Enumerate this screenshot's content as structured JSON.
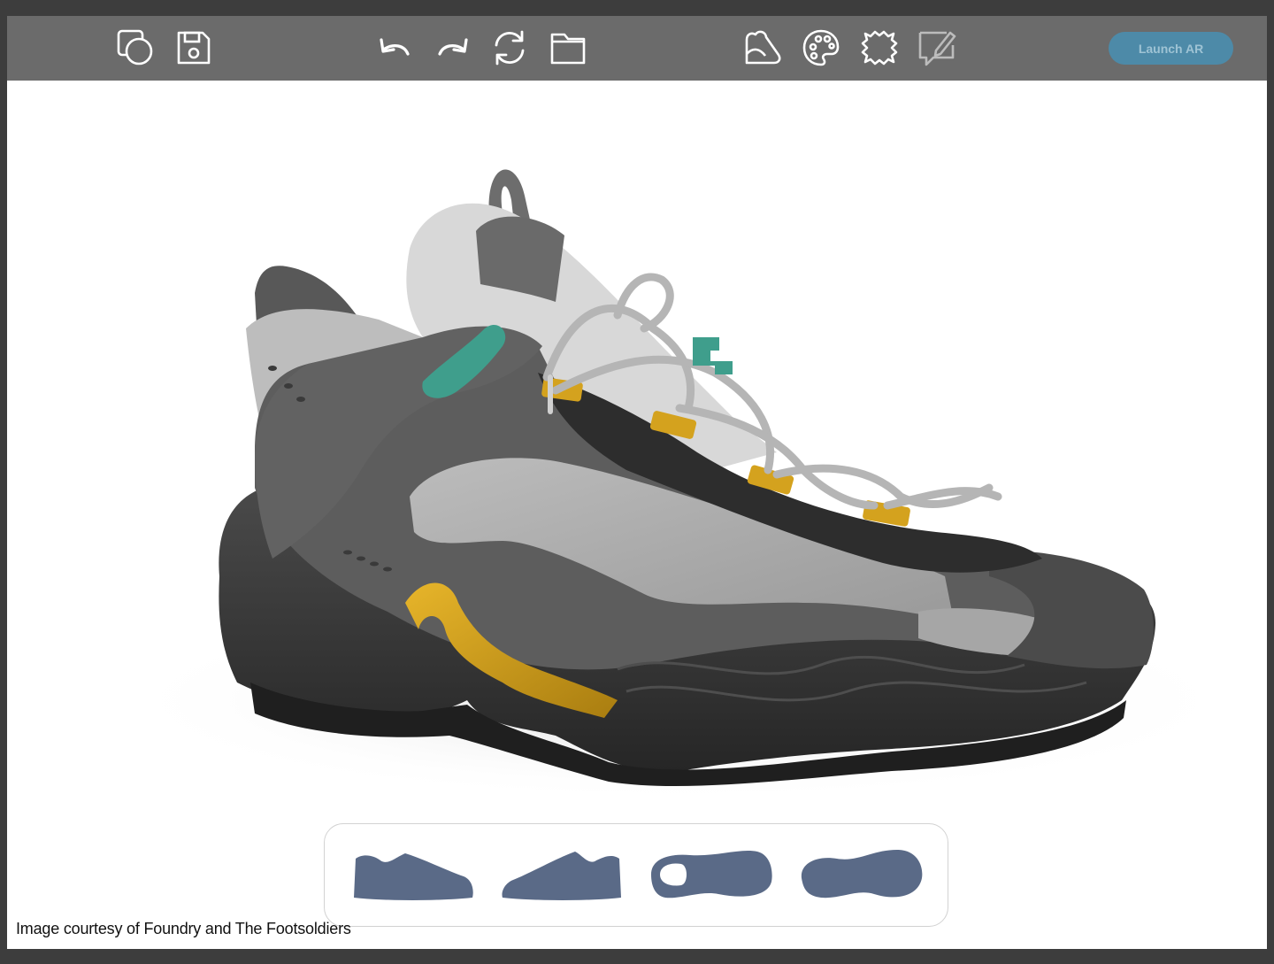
{
  "toolbar": {
    "left_tools": [
      {
        "icon": "new-shape-icon",
        "label": "New"
      },
      {
        "icon": "save-icon",
        "label": "Save"
      }
    ],
    "center_tools": [
      {
        "icon": "undo-icon"
      },
      {
        "icon": "redo-icon"
      },
      {
        "icon": "refresh-icon"
      },
      {
        "icon": "folder-icon"
      }
    ],
    "right_tools": [
      {
        "icon": "environment-icon"
      },
      {
        "icon": "palette-icon"
      },
      {
        "icon": "material-patch-icon"
      },
      {
        "icon": "annotate-icon",
        "disabled": true
      }
    ],
    "launch_ar_label": "Launch AR"
  },
  "viewport": {
    "subject": "sneaker-3d-model",
    "colors": {
      "sole": "#3a3a3a",
      "overlay": "#5d5d5d",
      "mesh": "#a9a9a9",
      "collar": "#cfcfcf",
      "accent_yellow": "#d4a21e",
      "accent_teal": "#3f9e8c"
    }
  },
  "view_switcher": {
    "views": [
      {
        "name": "side-view",
        "icon": "shoe-side-left-icon"
      },
      {
        "name": "side-view-alt",
        "icon": "shoe-side-right-icon"
      },
      {
        "name": "top-view",
        "icon": "shoe-top-icon"
      },
      {
        "name": "bottom-view",
        "icon": "shoe-sole-icon"
      }
    ],
    "icon_color": "#5a6a87"
  },
  "credit": "Image courtesy of Foundry and The Footsoldiers"
}
